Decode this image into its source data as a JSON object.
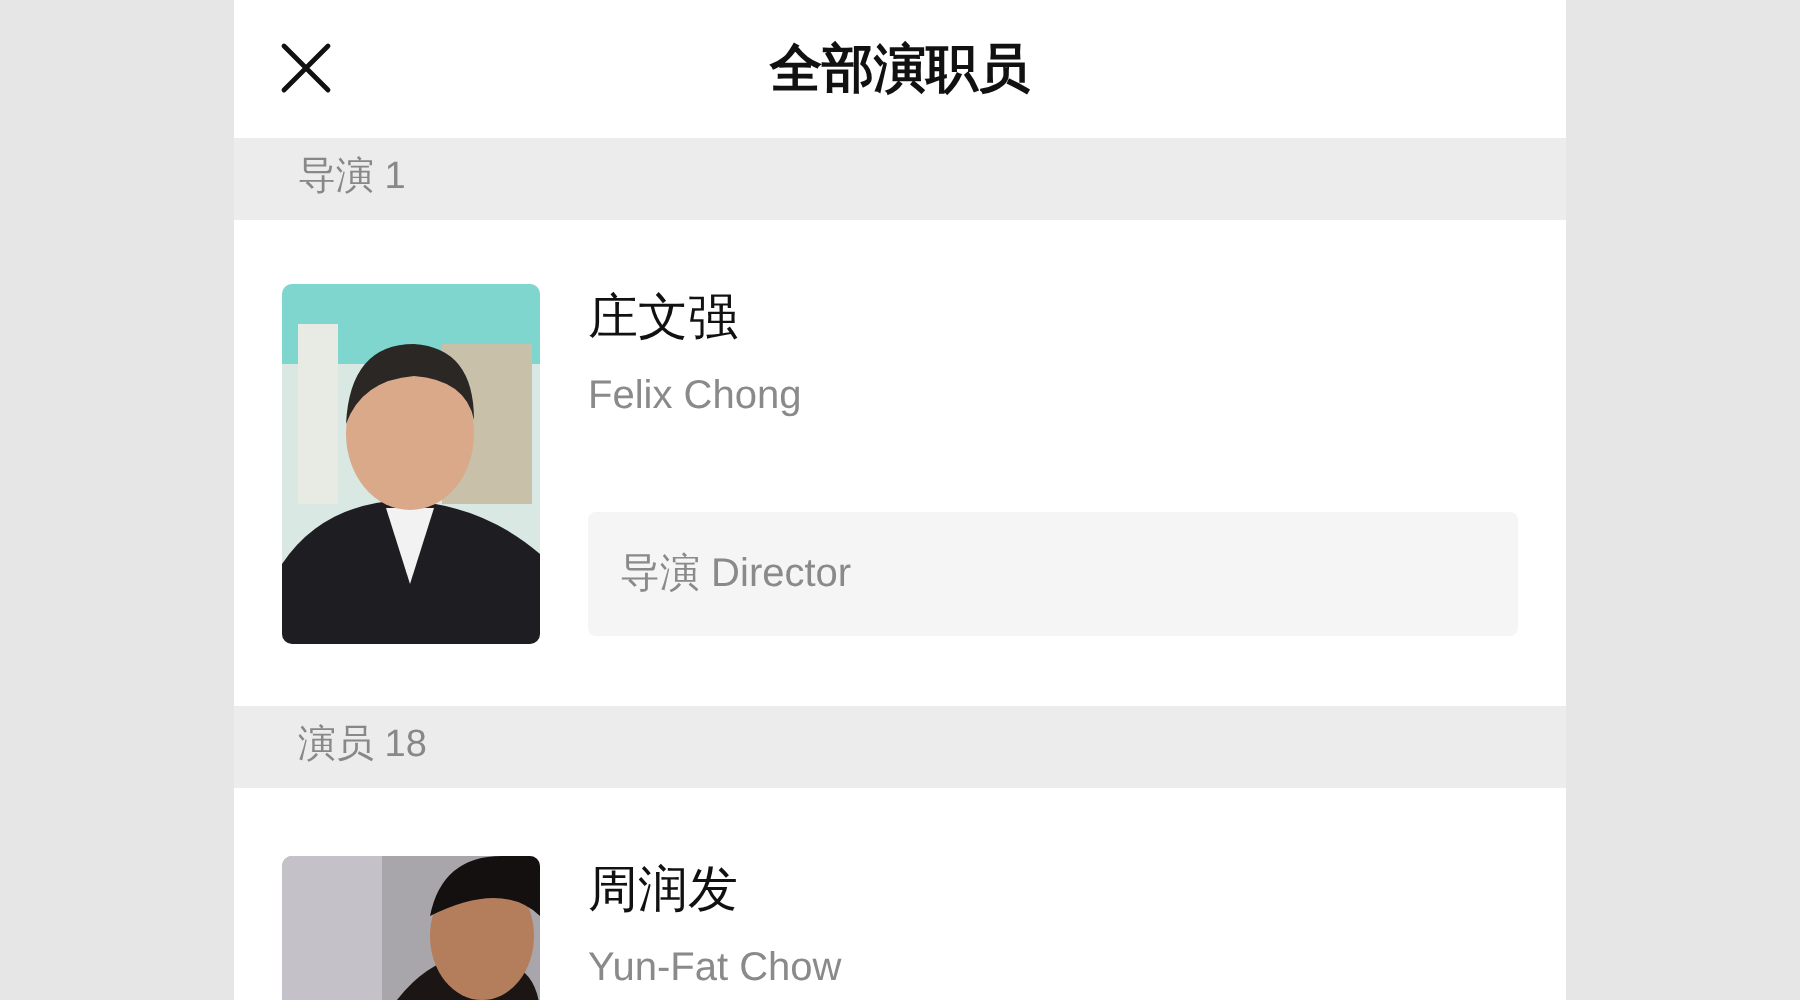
{
  "header": {
    "title": "全部演职员"
  },
  "sections": [
    {
      "heading": "导演 1",
      "people": [
        {
          "name": "庄文强",
          "english_name": "Felix Chong",
          "role": "导演 Director"
        }
      ]
    },
    {
      "heading": "演员 18",
      "people": [
        {
          "name": "周润发",
          "english_name": "Yun-Fat Chow"
        }
      ]
    }
  ]
}
